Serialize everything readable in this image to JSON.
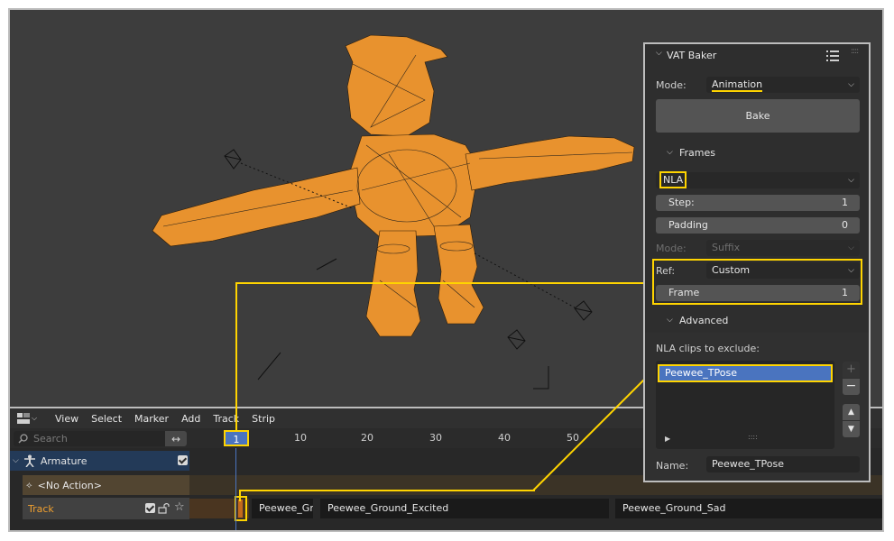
{
  "viewport": {
    "description_colors": {
      "mesh": "#f0a030",
      "wire": "#1a1a1a"
    }
  },
  "nla": {
    "menu": [
      "View",
      "Select",
      "Marker",
      "Add",
      "Track",
      "Strip"
    ],
    "search_placeholder": "Search",
    "current_frame": "1",
    "ruler_ticks": [
      "10",
      "20",
      "30",
      "40",
      "50"
    ],
    "channels": {
      "armature": "Armature",
      "action": "<No Action>",
      "track": "Track"
    },
    "strips": [
      "Peewee_Gr",
      "Peewee_Ground_Excited",
      "Peewee_Ground_Sad"
    ]
  },
  "panel": {
    "title": "VAT Baker",
    "mode_label": "Mode:",
    "mode_value": "Animation",
    "bake_button": "Bake",
    "frames_section": "Frames",
    "frames_source": "NLA",
    "step_label": "Step:",
    "step_value": "1",
    "padding_label": "Padding",
    "padding_value": "0",
    "mode2_label": "Mode:",
    "mode2_value": "Suffix",
    "ref_label": "Ref:",
    "ref_value": "Custom",
    "frame_label": "Frame",
    "frame_value": "1",
    "advanced_section": "Advanced",
    "exclude_label": "NLA clips to exclude:",
    "exclude_items": [
      "Peewee_TPose"
    ],
    "name_label": "Name:",
    "name_value": "Peewee_TPose"
  },
  "colors": {
    "accent": "#ffd400",
    "selection": "#4a74bf"
  }
}
